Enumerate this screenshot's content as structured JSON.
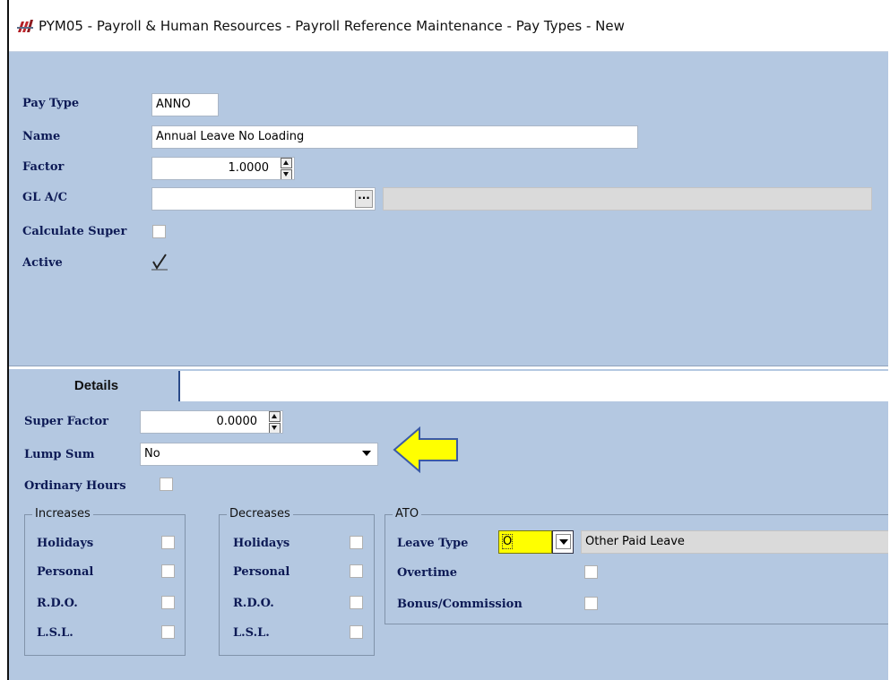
{
  "window": {
    "title": "PYM05 - Payroll & Human Resources - Payroll Reference Maintenance - Pay Types - New"
  },
  "header_form": {
    "pay_type": {
      "label": "Pay Type",
      "value": "ANNO"
    },
    "name": {
      "label": "Name",
      "value": "Annual Leave No Loading"
    },
    "factor": {
      "label": "Factor",
      "value": "1.0000"
    },
    "gl_account": {
      "label": "GL A/C",
      "value": "",
      "description": "",
      "lookup": "..."
    },
    "calculate_super": {
      "label": "Calculate Super",
      "checked": false
    },
    "active": {
      "label": "Active",
      "checked": true
    }
  },
  "tabs": [
    {
      "label": "Details",
      "active": true
    }
  ],
  "details": {
    "super_factor": {
      "label": "Super Factor",
      "value": "0.0000"
    },
    "lump_sum": {
      "label": "Lump Sum",
      "value": "No"
    },
    "ordinary_hours": {
      "label": "Ordinary Hours",
      "checked": false
    },
    "increases": {
      "title": "Increases",
      "items": [
        {
          "label": "Holidays",
          "checked": false
        },
        {
          "label": "Personal",
          "checked": false
        },
        {
          "label": "R.D.O.",
          "checked": false
        },
        {
          "label": "L.S.L.",
          "checked": false
        }
      ]
    },
    "decreases": {
      "title": "Decreases",
      "items": [
        {
          "label": "Holidays",
          "checked": false
        },
        {
          "label": "Personal",
          "checked": false
        },
        {
          "label": "R.D.O.",
          "checked": false
        },
        {
          "label": "L.S.L.",
          "checked": false
        }
      ]
    },
    "ato": {
      "title": "ATO",
      "leave_type": {
        "label": "Leave Type",
        "code": "O",
        "description": "Other Paid Leave"
      },
      "overtime": {
        "label": "Overtime",
        "checked": false
      },
      "bonus_commission": {
        "label": "Bonus/Commission",
        "checked": false
      }
    }
  },
  "colors": {
    "form_background": "#b4c8e1",
    "label_text": "#0d1a55",
    "highlight_field": "#ffff00",
    "callout_arrow": "#ffff00"
  }
}
